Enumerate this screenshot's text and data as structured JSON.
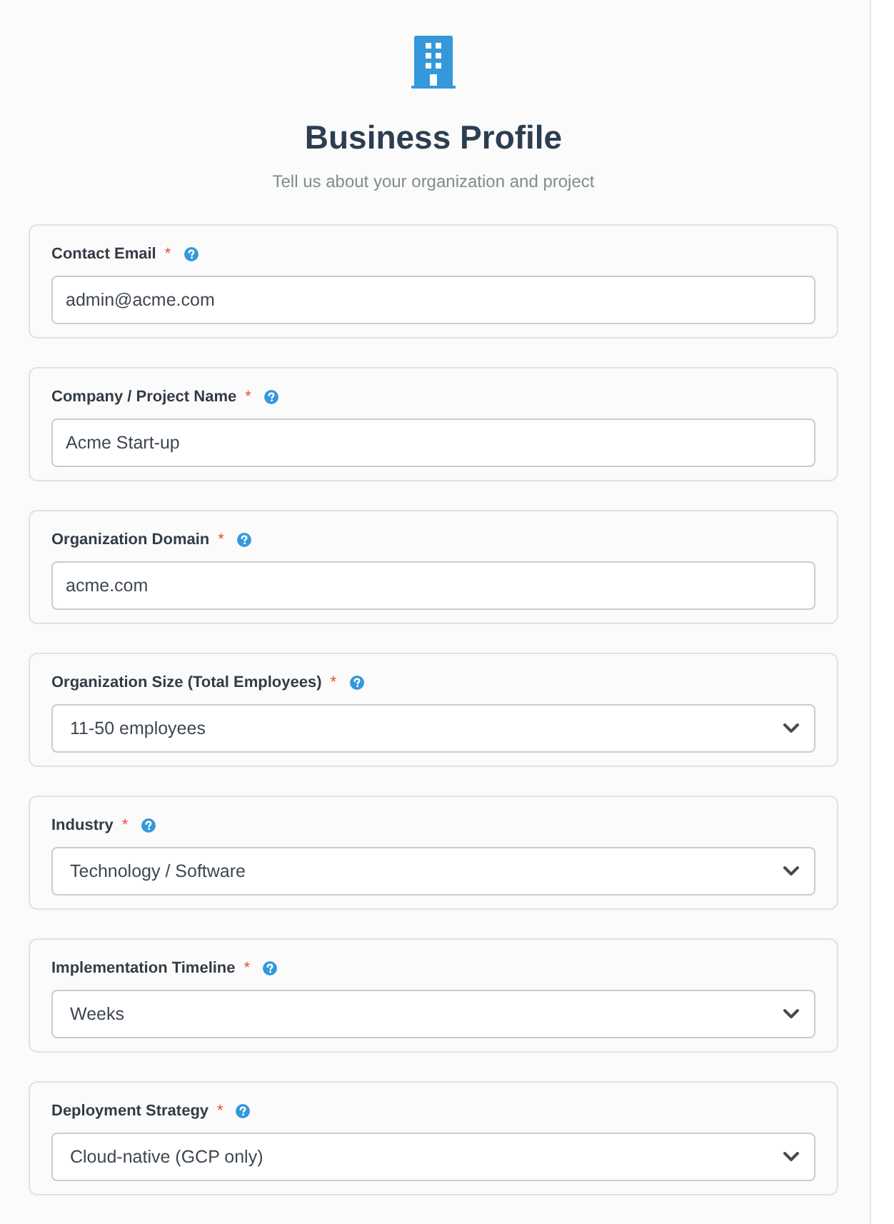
{
  "header": {
    "title": "Business Profile",
    "subtitle": "Tell us about your organization and project"
  },
  "fields": [
    {
      "kind": "text",
      "label": "Contact Email",
      "required_mark": "*",
      "value": "admin@acme.com"
    },
    {
      "kind": "text",
      "label": "Company / Project Name",
      "required_mark": "*",
      "value": "Acme Start-up"
    },
    {
      "kind": "text",
      "label": "Organization Domain",
      "required_mark": "*",
      "value": "acme.com"
    },
    {
      "kind": "select",
      "label": "Organization Size (Total Employees)",
      "required_mark": "*",
      "value": "11-50 employees"
    },
    {
      "kind": "select",
      "label": "Industry",
      "required_mark": "*",
      "value": "Technology / Software"
    },
    {
      "kind": "select",
      "label": "Implementation Timeline",
      "required_mark": "*",
      "value": "Weeks"
    },
    {
      "kind": "select",
      "label": "Deployment Strategy",
      "required_mark": "*",
      "value": "Cloud-native (GCP only)"
    }
  ]
}
